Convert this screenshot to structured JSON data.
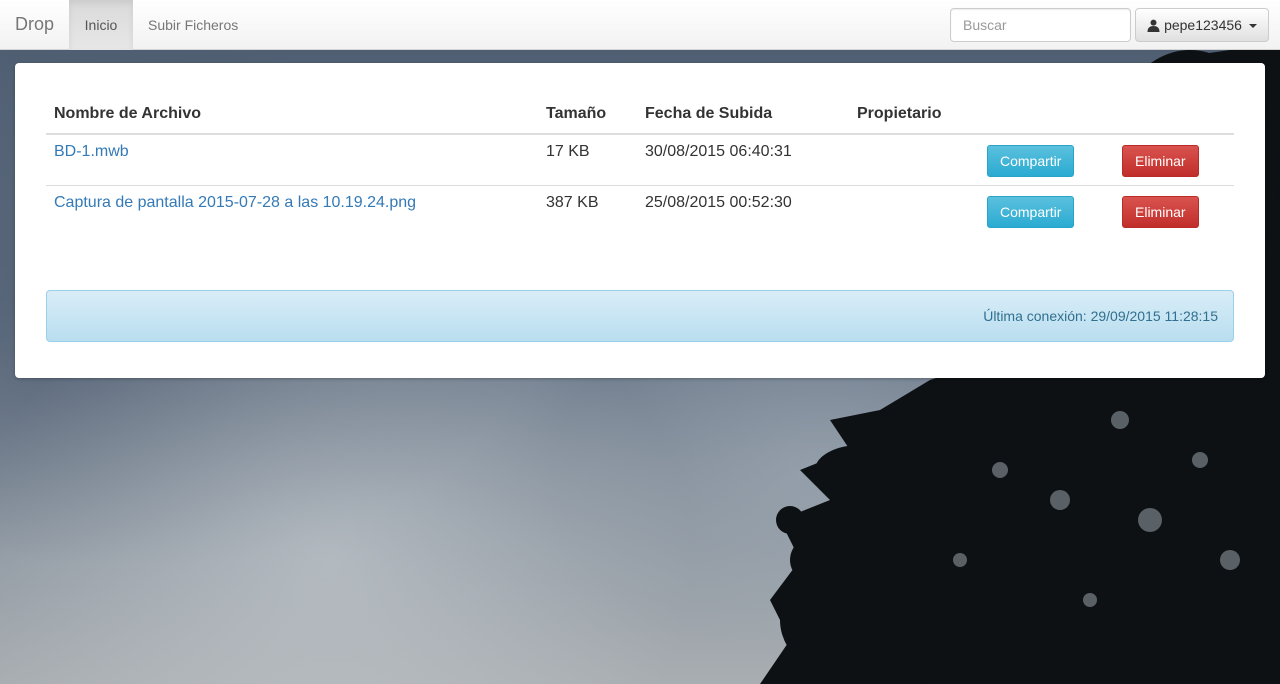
{
  "navbar": {
    "brand": "Drop",
    "items": [
      {
        "label": "Inicio",
        "active": true
      },
      {
        "label": "Subir Ficheros",
        "active": false
      }
    ],
    "search_placeholder": "Buscar",
    "user": {
      "icon": "user-icon",
      "name": "pepe123456"
    }
  },
  "table": {
    "headers": [
      "Nombre de Archivo",
      "Tamaño",
      "Fecha de Subida",
      "Propietario"
    ],
    "rows": [
      {
        "name": "BD-1.mwb",
        "size": "17 KB",
        "date": "30/08/2015 06:40:31",
        "owner": "",
        "share_label": "Compartir",
        "delete_label": "Eliminar"
      },
      {
        "name": "Captura de pantalla 2015-07-28 a las 10.19.24.png",
        "size": "387 KB",
        "date": "25/08/2015 00:52:30",
        "owner": "",
        "share_label": "Compartir",
        "delete_label": "Eliminar"
      }
    ]
  },
  "status": {
    "last_connection": "Última conexión: 29/09/2015 11:28:15"
  },
  "colors": {
    "link": "#337ab7",
    "info_button": "#5bc0de",
    "danger_button": "#d9534f",
    "alert_bg": "#d9edf7"
  }
}
